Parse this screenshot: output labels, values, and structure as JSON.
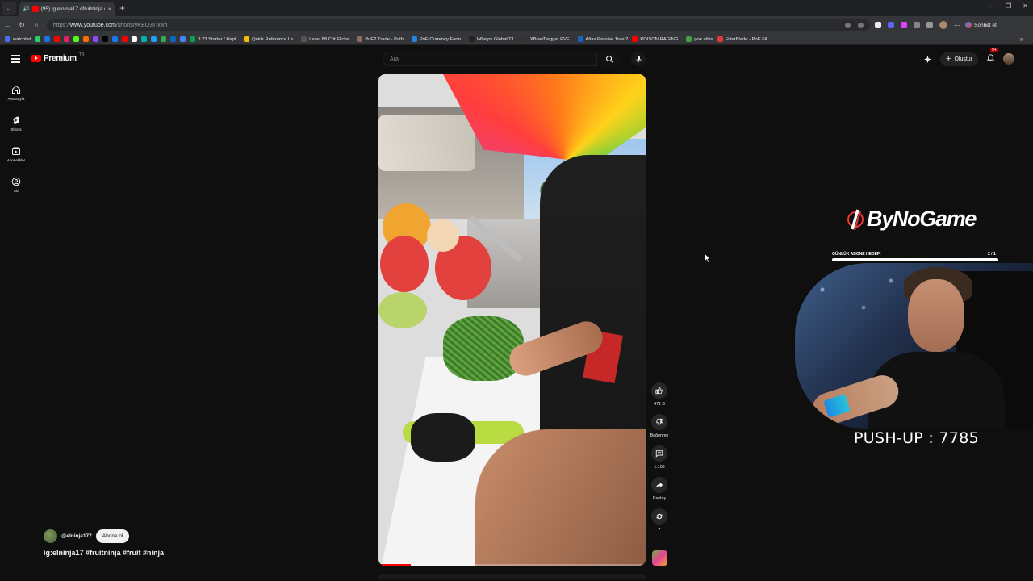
{
  "browser": {
    "tab_title": "(95) ig:elninja17 #fruitninja #f...",
    "url_prefix": "https://",
    "url_host": "www.youtube.com",
    "url_path": "/shorts/yKEQ3TIxwfI",
    "chat_button": "Sohbet et",
    "bookmarks": [
      {
        "label": "watchlist",
        "color": "#4a6cf7"
      },
      {
        "label": "",
        "color": "#25d366"
      },
      {
        "label": "",
        "color": "#1a73e8"
      },
      {
        "label": "",
        "color": "#ff0000"
      },
      {
        "label": "",
        "color": "#e91e63"
      },
      {
        "label": "",
        "color": "#53fc18"
      },
      {
        "label": "",
        "color": "#ff6d00"
      },
      {
        "label": "",
        "color": "#9146ff"
      },
      {
        "label": "",
        "color": "#000000"
      },
      {
        "label": "",
        "color": "#1877f2"
      },
      {
        "label": "",
        "color": "#ff0000"
      },
      {
        "label": "",
        "color": "#ffffff"
      },
      {
        "label": "",
        "color": "#00b2a9"
      },
      {
        "label": "",
        "color": "#1da1f2"
      },
      {
        "label": "",
        "color": "#34a853"
      },
      {
        "label": "",
        "color": "#0a66c2"
      },
      {
        "label": "",
        "color": "#4285f4"
      },
      {
        "label": "3.23 Starter / Hapl...",
        "color": "#0f9d58"
      },
      {
        "label": "Quick Reference Le...",
        "color": "#fbbc05"
      },
      {
        "label": "Level 88 Crit Flicke...",
        "color": "#555555"
      },
      {
        "label": "PoE2 Trade - Path...",
        "color": "#8d6e63"
      },
      {
        "label": "PoE Currency Farm...",
        "color": "#1e88e5"
      },
      {
        "label": "Whelps Global T1...",
        "color": "#222222"
      },
      {
        "label": "XBow/Dagger PVE...",
        "color": "#333333"
      },
      {
        "label": "Atlas Passive Tree 2",
        "color": "#1565c0"
      },
      {
        "label": "POISON RAGING...",
        "color": "#ff0000"
      },
      {
        "label": "poe atlas",
        "color": "#43a047"
      },
      {
        "label": "FilterBlade - PoE Fil...",
        "color": "#e53935"
      }
    ]
  },
  "youtube": {
    "logo_text": "Premium",
    "country_code": "TR",
    "search_placeholder": "Ara",
    "create_label": "Oluştur",
    "notif_count": "9+",
    "guide": [
      {
        "icon": "home-icon",
        "label": "Ana Sayfa"
      },
      {
        "icon": "shorts-icon",
        "label": "Shorts"
      },
      {
        "icon": "subscriptions-icon",
        "label": "Abonelikler"
      },
      {
        "icon": "you-icon",
        "label": "Siz"
      }
    ],
    "actions": [
      {
        "icon": "like-icon",
        "label": "471 B"
      },
      {
        "icon": "dislike-icon",
        "label": "Beğenme"
      },
      {
        "icon": "comment-icon",
        "label": "1.108"
      },
      {
        "icon": "share-icon",
        "label": "Paylaş"
      },
      {
        "icon": "remix-icon",
        "label": "7"
      }
    ],
    "channel_handle": "@elninja177",
    "subscribe_label": "Abone ol",
    "video_title": "ig:elninja17 #fruitninja #fruit #ninja",
    "progress": 0.12
  },
  "stream_overlay": {
    "brand": "ByNoGame",
    "goal_label": "GÜNLÜK ABONE HEDEFİ",
    "goal_count": "2 / 1",
    "goal_progress": 1.0,
    "pushup_text": "PUSH-UP : 7785"
  }
}
